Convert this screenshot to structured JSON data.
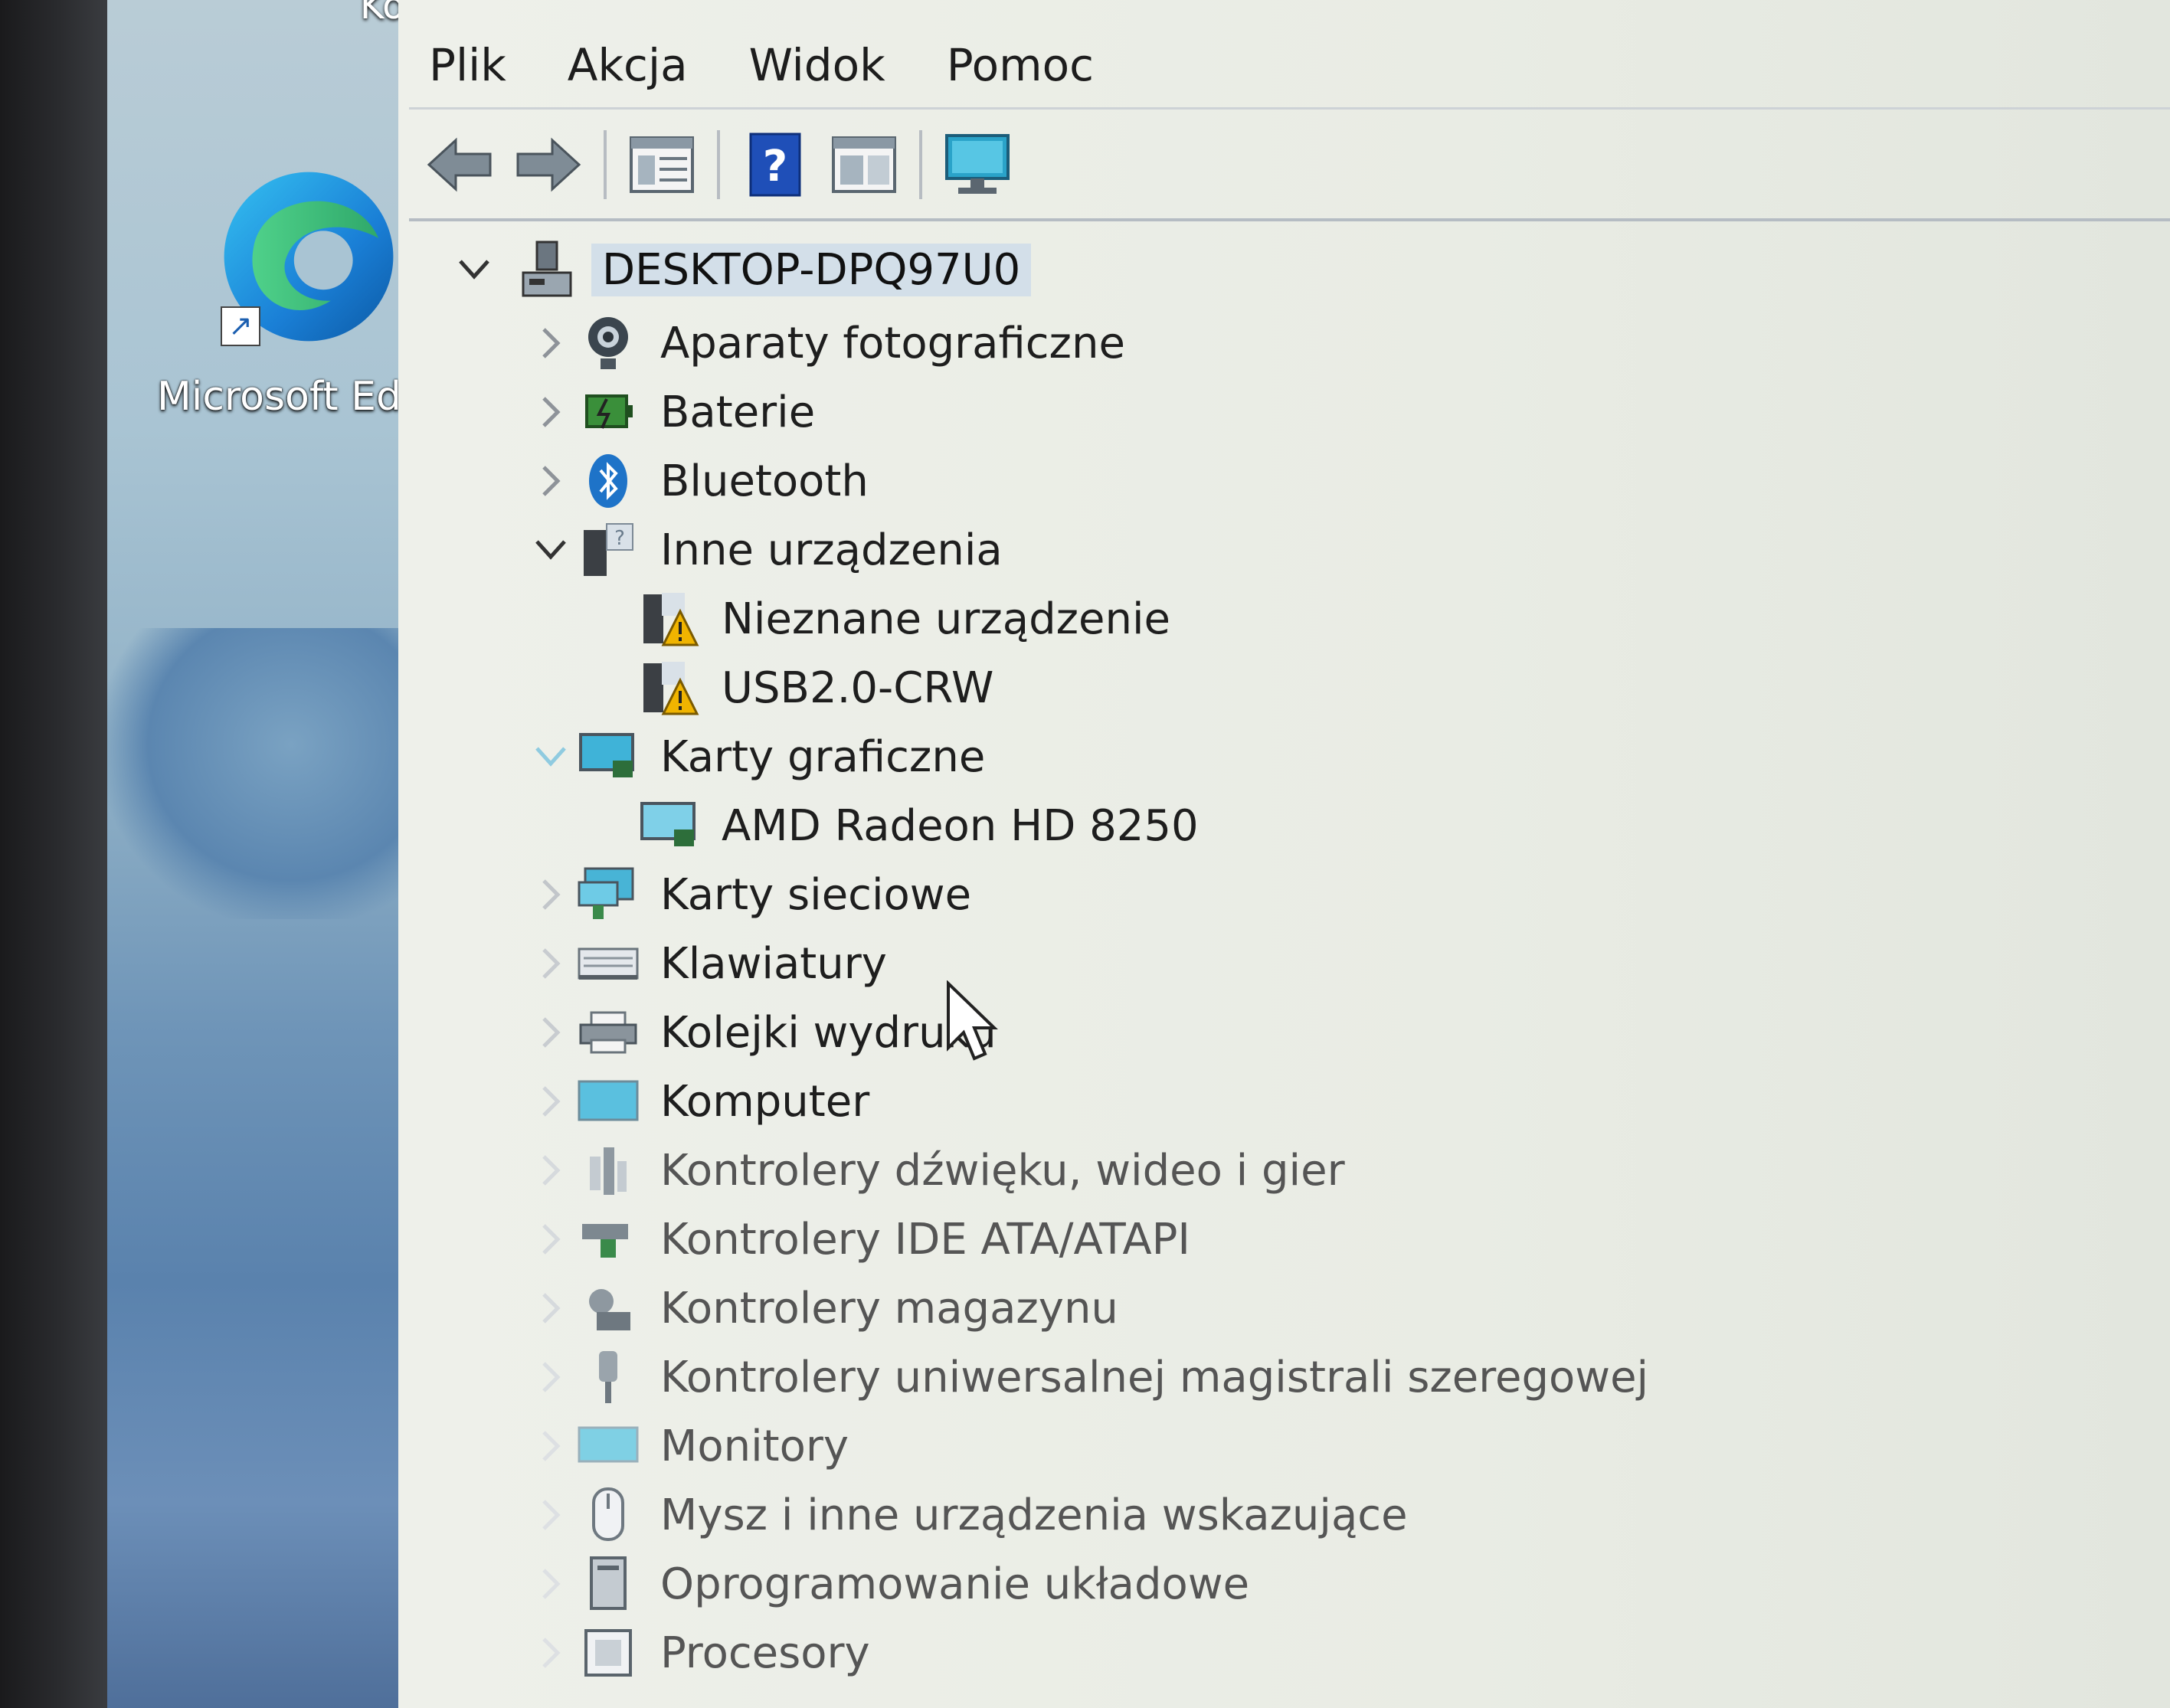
{
  "desktop": {
    "recycle_bin_label": "Kosz",
    "edge_label": "Microsoft Ed"
  },
  "menu": [
    "Plik",
    "Akcja",
    "Widok",
    "Pomoc"
  ],
  "toolbar": {
    "icons": [
      "back-arrow-icon",
      "forward-arrow-icon",
      "properties-grid-icon",
      "help-icon",
      "view-grid-icon",
      "monitor-icon"
    ]
  },
  "tree": {
    "root": "DESKTOP-DPQ97U0",
    "items": [
      {
        "label": "Aparaty fotograficzne",
        "icon": "camera-icon",
        "expanded": false
      },
      {
        "label": "Baterie",
        "icon": "battery-icon",
        "expanded": false
      },
      {
        "label": "Bluetooth",
        "icon": "bluetooth-icon",
        "expanded": false
      },
      {
        "label": "Inne urządzenia",
        "icon": "unknown-device-icon",
        "expanded": true,
        "children": [
          "Nieznane urządzenie",
          "USB2.0-CRW"
        ]
      },
      {
        "label": "Karty graficzne",
        "icon": "display-adapter-icon",
        "expanded": true,
        "children": [
          "AMD Radeon HD 8250"
        ]
      },
      {
        "label": "Karty sieciowe",
        "icon": "network-adapter-icon",
        "expanded": false
      },
      {
        "label": "Klawiatury",
        "icon": "keyboard-icon",
        "expanded": false
      },
      {
        "label": "Kolejki wydruku",
        "icon": "printer-icon",
        "expanded": false
      },
      {
        "label": "Komputer",
        "icon": "computer-icon",
        "expanded": false
      },
      {
        "label": "Kontrolery dźwięku, wideo i gier",
        "icon": "sound-icon",
        "expanded": false
      },
      {
        "label": "Kontrolery IDE ATA/ATAPI",
        "icon": "ide-icon",
        "expanded": false
      },
      {
        "label": "Kontrolery magazynu",
        "icon": "storage-icon",
        "expanded": false
      },
      {
        "label": "Kontrolery uniwersalnej magistrali szeregowej",
        "icon": "usb-icon",
        "expanded": false
      },
      {
        "label": "Monitory",
        "icon": "monitor-icon",
        "expanded": false
      },
      {
        "label": "Mysz i inne urządzenia wskazujące",
        "icon": "mouse-icon",
        "expanded": false
      },
      {
        "label": "Oprogramowanie układowe",
        "icon": "firmware-icon",
        "expanded": false
      },
      {
        "label": "Procesory",
        "icon": "processor-icon",
        "expanded": false
      }
    ]
  },
  "colors": {
    "window_bg": "#eceee8",
    "selection": "#d3dfe9",
    "warning": "#f0b400"
  }
}
